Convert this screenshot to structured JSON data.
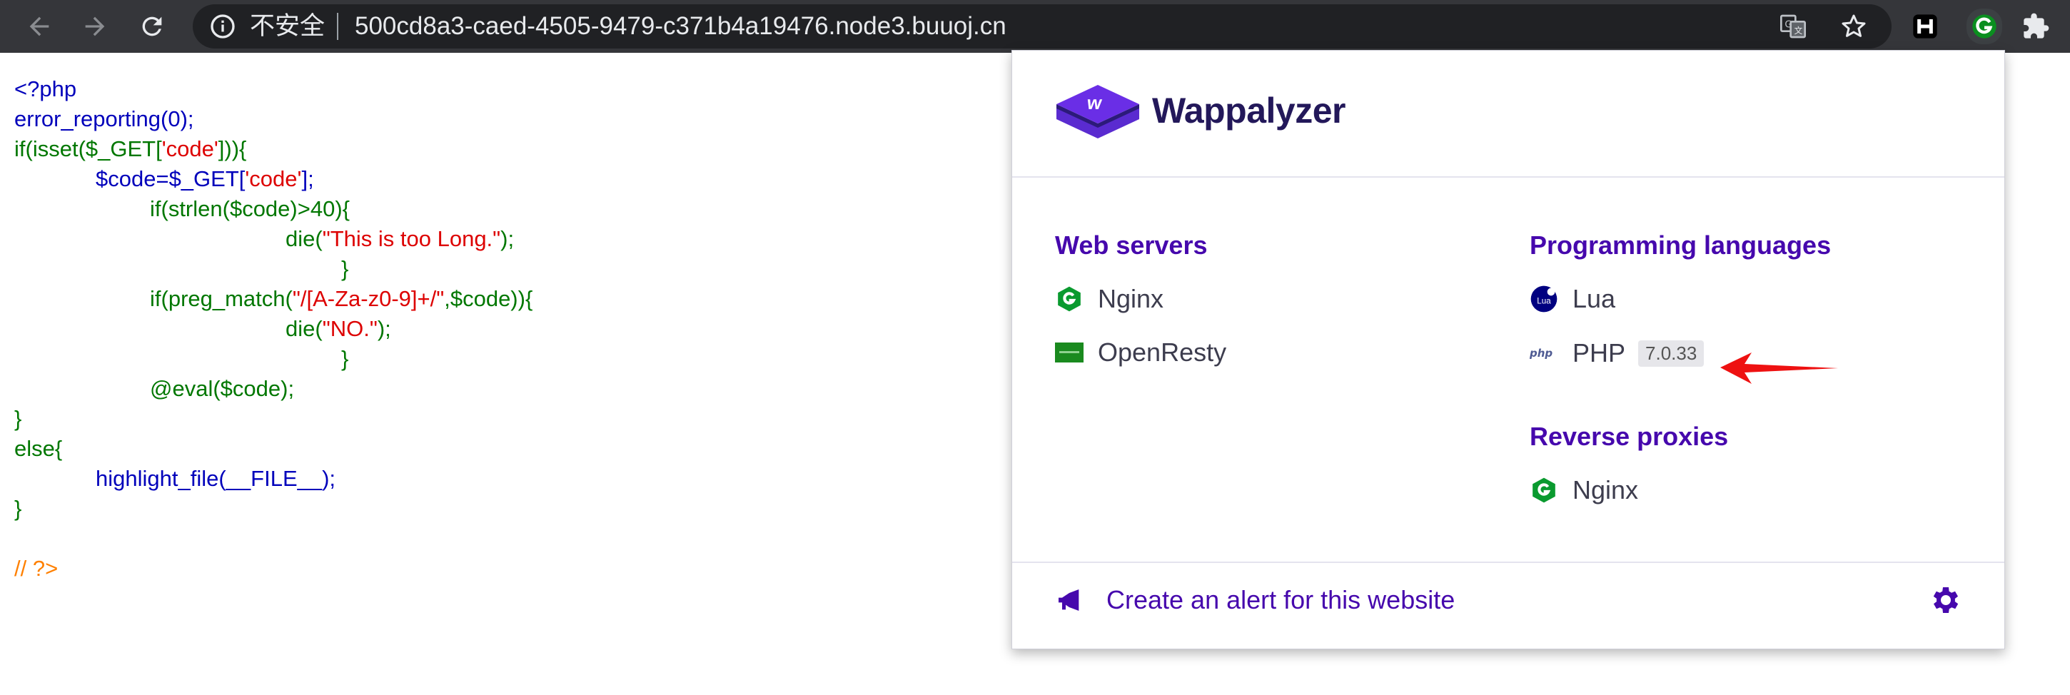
{
  "browser": {
    "security_label": "不安全",
    "url": "500cd8a3-caed-4505-9479-c371b4a19476.node3.buuoj.cn",
    "icons": [
      "back-arrow-icon",
      "forward-arrow-icon",
      "reload-icon",
      "info-icon",
      "translate-icon",
      "star-icon",
      "h-extension-icon",
      "wappalyzer-g-icon",
      "puzzle-icon"
    ]
  },
  "code_lines": [
    [
      "<?php"
    ],
    [
      "error_reporting(0);"
    ],
    [
      "if(isset($_GET[",
      "'code'",
      "])){"
    ],
    [
      "$code=$_GET[",
      "'code'",
      "];"
    ],
    [
      "if(strlen($code)>40){"
    ],
    [
      "die(",
      "\"This is too Long.\"",
      ");"
    ],
    [
      "}"
    ],
    [
      "if(preg_match(",
      "\"/[A-Za-z0-9]+/\"",
      ",$code)){"
    ],
    [
      "die(",
      "\"NO.\"",
      ");"
    ],
    [
      "}"
    ],
    [
      "@eval($code);"
    ],
    [
      "}"
    ],
    [
      "else{"
    ],
    [
      "highlight_file(__FILE__);"
    ],
    [
      "}"
    ],
    [
      "// ?>"
    ]
  ],
  "popup": {
    "brand": "Wappalyzer",
    "categories": {
      "web_servers": {
        "title": "Web servers",
        "items": [
          {
            "name": "Nginx",
            "icon": "nginx-icon"
          },
          {
            "name": "OpenResty",
            "icon": "openresty-icon"
          }
        ]
      },
      "programming_languages": {
        "title": "Programming languages",
        "items": [
          {
            "name": "Lua",
            "icon": "lua-icon"
          },
          {
            "name": "PHP",
            "icon": "php-icon",
            "version": "7.0.33",
            "icon_text": "php"
          }
        ]
      },
      "reverse_proxies": {
        "title": "Reverse proxies",
        "items": [
          {
            "name": "Nginx",
            "icon": "nginx-icon"
          }
        ]
      }
    },
    "alert_text": "Create an alert for this website",
    "lua_icon_text": "Lua",
    "accent_color": "#4608ad"
  },
  "colors": {
    "php_keyword": "#007700",
    "php_default": "#0000BB",
    "php_string": "#DD0000",
    "php_comment": "#FF8000",
    "annotation_arrow": "#ee1111"
  }
}
